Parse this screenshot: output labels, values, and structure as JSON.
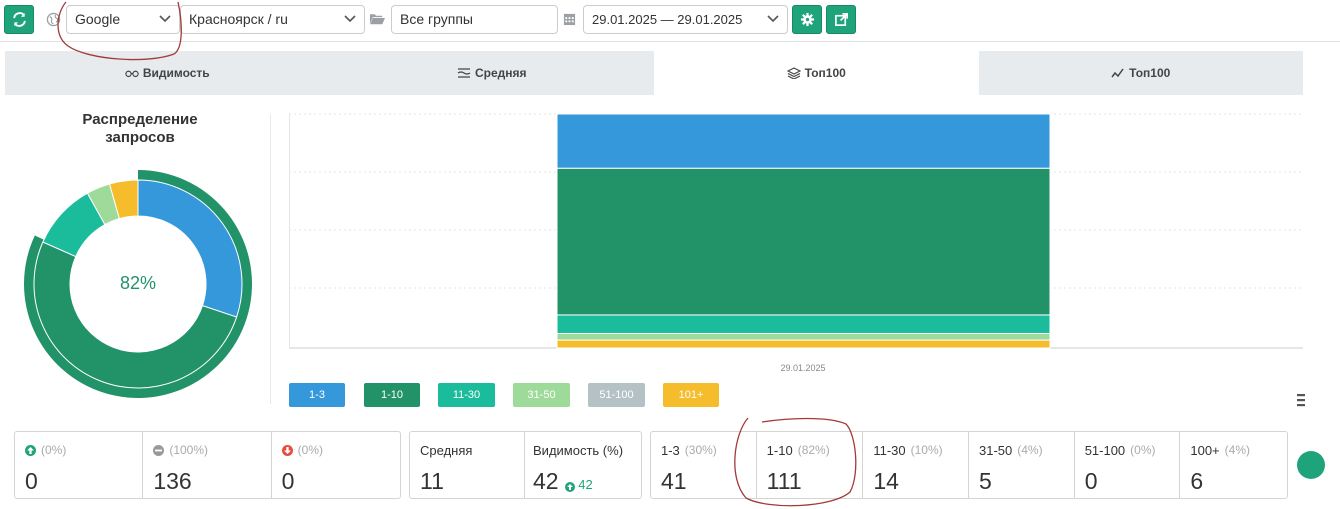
{
  "toolbar": {
    "search_engine": "Google",
    "region": "Красноярск / ru",
    "group": "Все группы",
    "date_range": "29.01.2025 — 29.01.2025"
  },
  "tabs": [
    {
      "label": "Видимость",
      "icon": "glasses-icon",
      "active": false
    },
    {
      "label": "Средняя",
      "icon": "lines-icon",
      "active": false
    },
    {
      "label": "Топ100",
      "icon": "layers-icon",
      "active": true
    },
    {
      "label": "Топ100",
      "icon": "line-chart-icon",
      "active": false
    }
  ],
  "distribution": {
    "title": "Распределение запросов",
    "center_label": "82%"
  },
  "colors": {
    "accent": "#1fa37b",
    "c1_3": "#3498db",
    "c1_10": "#229369",
    "c11_30": "#1abc9c",
    "c31_50": "#9edb9a",
    "c51_100": "#b4c2c6",
    "c101": "#f5bd2c"
  },
  "chart_data": {
    "type": "bar",
    "categories": [
      "29.01.2025"
    ],
    "stacked": true,
    "series": [
      {
        "name": "1-3",
        "values": [
          41
        ]
      },
      {
        "name": "1-10",
        "values": [
          111
        ]
      },
      {
        "name": "11-30",
        "values": [
          14
        ]
      },
      {
        "name": "31-50",
        "values": [
          5
        ]
      },
      {
        "name": "51-100",
        "values": [
          0
        ]
      },
      {
        "name": "101+",
        "values": [
          6
        ]
      }
    ],
    "grid": true,
    "legend": "bottom-left",
    "donut": {
      "segments": [
        {
          "name": "1-3",
          "value": 41
        },
        {
          "name": "4-10",
          "value": 70
        },
        {
          "name": "11-30",
          "value": 14
        },
        {
          "name": "31-50",
          "value": 5
        },
        {
          "name": "101+",
          "value": 6
        }
      ],
      "outer_ring_fraction": 0.82
    }
  },
  "legend": [
    "1-3",
    "1-10",
    "11-30",
    "31-50",
    "51-100",
    "101+"
  ],
  "x_tick": "29.01.2025",
  "stats": {
    "dynamics": [
      {
        "pct": "(0%)",
        "value": "0",
        "icon": "arrow-up-icon"
      },
      {
        "pct": "(100%)",
        "value": "136",
        "icon": "minus-circle-icon"
      },
      {
        "pct": "(0%)",
        "value": "0",
        "icon": "arrow-down-icon"
      }
    ],
    "average": {
      "label": "Средняя",
      "value": "11"
    },
    "visibility": {
      "label": "Видимость (%)",
      "value": "42",
      "delta": "42"
    },
    "ranges": [
      {
        "label": "1-3",
        "pct": "(30%)",
        "value": "41"
      },
      {
        "label": "1-10",
        "pct": "(82%)",
        "value": "111"
      },
      {
        "label": "11-30",
        "pct": "(10%)",
        "value": "14"
      },
      {
        "label": "31-50",
        "pct": "(4%)",
        "value": "5"
      },
      {
        "label": "51-100",
        "pct": "(0%)",
        "value": "0"
      },
      {
        "label": "100+",
        "pct": "(4%)",
        "value": "6"
      }
    ]
  }
}
